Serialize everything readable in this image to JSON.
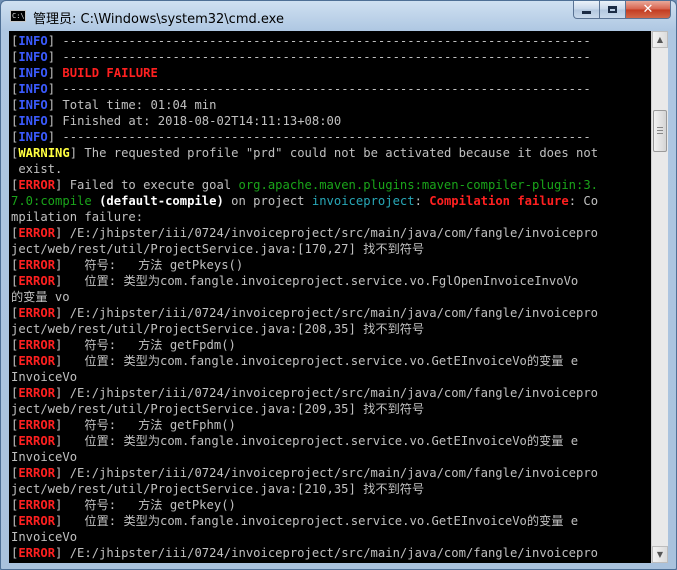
{
  "window": {
    "title": "管理员: C:\\Windows\\system32\\cmd.exe",
    "icon": "cmd-icon",
    "controls": {
      "minimize": "minimize-icon",
      "maximize": "maximize-icon",
      "close": "✕"
    }
  },
  "colors": {
    "info_tag": "#3b5bff",
    "error_tag": "#ff2020",
    "warning_tag": "#ffff40",
    "green_text": "#1aa51a",
    "cyan_text": "#28a8b8",
    "console_bg": "#000000"
  },
  "console": {
    "lines": [
      [
        {
          "c": "bk",
          "v": "["
        },
        {
          "c": "tag-info",
          "v": "INFO"
        },
        {
          "c": "bk",
          "v": "] "
        },
        {
          "c": "t",
          "v": "------------------------------------------------------------------------"
        }
      ],
      [
        {
          "c": "bk",
          "v": "["
        },
        {
          "c": "tag-info",
          "v": "INFO"
        },
        {
          "c": "bk",
          "v": "] "
        },
        {
          "c": "t",
          "v": "------------------------------------------------------------------------"
        }
      ],
      [
        {
          "c": "bk",
          "v": "["
        },
        {
          "c": "tag-info",
          "v": "INFO"
        },
        {
          "c": "bk",
          "v": "] "
        },
        {
          "c": "t red",
          "v": "BUILD FAILURE"
        }
      ],
      [
        {
          "c": "bk",
          "v": "["
        },
        {
          "c": "tag-info",
          "v": "INFO"
        },
        {
          "c": "bk",
          "v": "] "
        },
        {
          "c": "t",
          "v": "------------------------------------------------------------------------"
        }
      ],
      [
        {
          "c": "bk",
          "v": "["
        },
        {
          "c": "tag-info",
          "v": "INFO"
        },
        {
          "c": "bk",
          "v": "] "
        },
        {
          "c": "t",
          "v": "Total time: 01:04 min"
        }
      ],
      [
        {
          "c": "bk",
          "v": "["
        },
        {
          "c": "tag-info",
          "v": "INFO"
        },
        {
          "c": "bk",
          "v": "] "
        },
        {
          "c": "t",
          "v": "Finished at: 2018-08-02T14:11:13+08:00"
        }
      ],
      [
        {
          "c": "bk",
          "v": "["
        },
        {
          "c": "tag-info",
          "v": "INFO"
        },
        {
          "c": "bk",
          "v": "] "
        },
        {
          "c": "t",
          "v": "------------------------------------------------------------------------"
        }
      ],
      [
        {
          "c": "bk",
          "v": "["
        },
        {
          "c": "tag-warn",
          "v": "WARNING"
        },
        {
          "c": "bk",
          "v": "] "
        },
        {
          "c": "t",
          "v": "The requested profile \"prd\" could not be activated because it does not"
        }
      ],
      [
        {
          "c": "t",
          "v": " exist."
        }
      ],
      [
        {
          "c": "bk",
          "v": "["
        },
        {
          "c": "tag-error",
          "v": "ERROR"
        },
        {
          "c": "bk",
          "v": "] "
        },
        {
          "c": "t",
          "v": "Failed to execute goal "
        },
        {
          "c": "t green",
          "v": "org.apache.maven.plugins:maven-compiler-plugin:3."
        }
      ],
      [
        {
          "c": "t green",
          "v": "7.0:compile"
        },
        {
          "c": "t",
          "v": " "
        },
        {
          "c": "t bold",
          "v": "(default-compile)"
        },
        {
          "c": "t",
          "v": " on project "
        },
        {
          "c": "t cyan",
          "v": "invoiceproject"
        },
        {
          "c": "t",
          "v": ": "
        },
        {
          "c": "t red",
          "v": "Compilation failure"
        },
        {
          "c": "t",
          "v": ": Co"
        }
      ],
      [
        {
          "c": "t",
          "v": "mpilation failure:"
        }
      ],
      [
        {
          "c": "bk",
          "v": "["
        },
        {
          "c": "tag-error",
          "v": "ERROR"
        },
        {
          "c": "bk",
          "v": "] "
        },
        {
          "c": "t",
          "v": "/E:/jhipster/iii/0724/invoiceproject/src/main/java/com/fangle/invoicepro"
        }
      ],
      [
        {
          "c": "t",
          "v": "ject/web/rest/util/ProjectService.java:[170,27] 找不到符号"
        }
      ],
      [
        {
          "c": "bk",
          "v": "["
        },
        {
          "c": "tag-error",
          "v": "ERROR"
        },
        {
          "c": "bk",
          "v": "] "
        },
        {
          "c": "t",
          "v": "  符号:   方法 getPkeys()"
        }
      ],
      [
        {
          "c": "bk",
          "v": "["
        },
        {
          "c": "tag-error",
          "v": "ERROR"
        },
        {
          "c": "bk",
          "v": "] "
        },
        {
          "c": "t",
          "v": "  位置: 类型为com.fangle.invoiceproject.service.vo.FglOpenInvoiceInvoVo"
        }
      ],
      [
        {
          "c": "t",
          "v": "的变量 vo"
        }
      ],
      [
        {
          "c": "bk",
          "v": "["
        },
        {
          "c": "tag-error",
          "v": "ERROR"
        },
        {
          "c": "bk",
          "v": "] "
        },
        {
          "c": "t",
          "v": "/E:/jhipster/iii/0724/invoiceproject/src/main/java/com/fangle/invoicepro"
        }
      ],
      [
        {
          "c": "t",
          "v": "ject/web/rest/util/ProjectService.java:[208,35] 找不到符号"
        }
      ],
      [
        {
          "c": "bk",
          "v": "["
        },
        {
          "c": "tag-error",
          "v": "ERROR"
        },
        {
          "c": "bk",
          "v": "] "
        },
        {
          "c": "t",
          "v": "  符号:   方法 getFpdm()"
        }
      ],
      [
        {
          "c": "bk",
          "v": "["
        },
        {
          "c": "tag-error",
          "v": "ERROR"
        },
        {
          "c": "bk",
          "v": "] "
        },
        {
          "c": "t",
          "v": "  位置: 类型为com.fangle.invoiceproject.service.vo.GetEInvoiceVo的变量 e"
        }
      ],
      [
        {
          "c": "t",
          "v": "InvoiceVo"
        }
      ],
      [
        {
          "c": "bk",
          "v": "["
        },
        {
          "c": "tag-error",
          "v": "ERROR"
        },
        {
          "c": "bk",
          "v": "] "
        },
        {
          "c": "t",
          "v": "/E:/jhipster/iii/0724/invoiceproject/src/main/java/com/fangle/invoicepro"
        }
      ],
      [
        {
          "c": "t",
          "v": "ject/web/rest/util/ProjectService.java:[209,35] 找不到符号"
        }
      ],
      [
        {
          "c": "bk",
          "v": "["
        },
        {
          "c": "tag-error",
          "v": "ERROR"
        },
        {
          "c": "bk",
          "v": "] "
        },
        {
          "c": "t",
          "v": "  符号:   方法 getFphm()"
        }
      ],
      [
        {
          "c": "bk",
          "v": "["
        },
        {
          "c": "tag-error",
          "v": "ERROR"
        },
        {
          "c": "bk",
          "v": "] "
        },
        {
          "c": "t",
          "v": "  位置: 类型为com.fangle.invoiceproject.service.vo.GetEInvoiceVo的变量 e"
        }
      ],
      [
        {
          "c": "t",
          "v": "InvoiceVo"
        }
      ],
      [
        {
          "c": "bk",
          "v": "["
        },
        {
          "c": "tag-error",
          "v": "ERROR"
        },
        {
          "c": "bk",
          "v": "] "
        },
        {
          "c": "t",
          "v": "/E:/jhipster/iii/0724/invoiceproject/src/main/java/com/fangle/invoicepro"
        }
      ],
      [
        {
          "c": "t",
          "v": "ject/web/rest/util/ProjectService.java:[210,35] 找不到符号"
        }
      ],
      [
        {
          "c": "bk",
          "v": "["
        },
        {
          "c": "tag-error",
          "v": "ERROR"
        },
        {
          "c": "bk",
          "v": "] "
        },
        {
          "c": "t",
          "v": "  符号:   方法 getPkey()"
        }
      ],
      [
        {
          "c": "bk",
          "v": "["
        },
        {
          "c": "tag-error",
          "v": "ERROR"
        },
        {
          "c": "bk",
          "v": "] "
        },
        {
          "c": "t",
          "v": "  位置: 类型为com.fangle.invoiceproject.service.vo.GetEInvoiceVo的变量 e"
        }
      ],
      [
        {
          "c": "t",
          "v": "InvoiceVo"
        }
      ],
      [
        {
          "c": "bk",
          "v": "["
        },
        {
          "c": "tag-error",
          "v": "ERROR"
        },
        {
          "c": "bk",
          "v": "] "
        },
        {
          "c": "t",
          "v": "/E:/jhipster/iii/0724/invoiceproject/src/main/java/com/fangle/invoicepro"
        }
      ]
    ]
  },
  "scrollbar": {
    "up": "▲",
    "down": "▼"
  }
}
